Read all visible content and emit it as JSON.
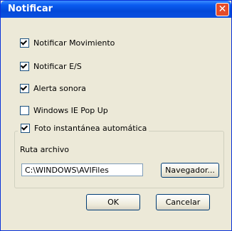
{
  "window": {
    "title": "Notificar",
    "close_label": "✕"
  },
  "options": [
    {
      "label": "Notificar Movimiento",
      "checked": true
    },
    {
      "label": "Notificar E/S",
      "checked": true
    },
    {
      "label": "Alerta sonora",
      "checked": true
    },
    {
      "label": "Windows IE Pop Up",
      "checked": false
    }
  ],
  "snapshot": {
    "label": "Foto instantánea automática",
    "checked": true,
    "path_label": "Ruta archivo",
    "path_value": "C:\\WINDOWS\\AVIFiles",
    "browse_label": "Navegador..."
  },
  "buttons": {
    "ok_label": "OK",
    "cancel_label": "Cancelar"
  }
}
